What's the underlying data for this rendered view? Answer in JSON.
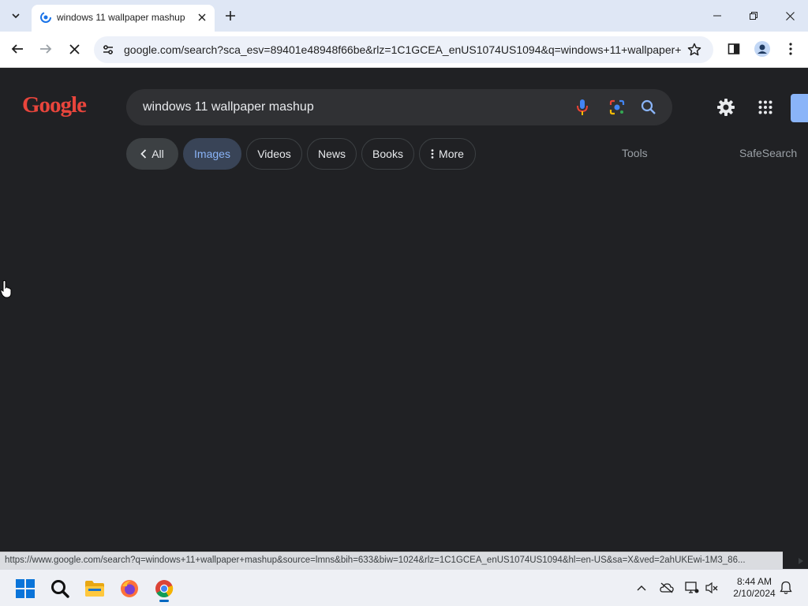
{
  "browser": {
    "tab_title": "windows 11 wallpaper mashup",
    "url": "google.com/search?sca_esv=89401e48948f66be&rlz=1C1GCEA_enUS1074US1094&q=windows+11+wallpaper+..."
  },
  "google": {
    "logo_text": "Google",
    "search_query": "windows 11 wallpaper mashup",
    "chips": {
      "all": "All",
      "images": "Images",
      "videos": "Videos",
      "news": "News",
      "books": "Books",
      "more": "More"
    },
    "tools": "Tools",
    "safesearch": "SafeSearch"
  },
  "status_url": "https://www.google.com/search?q=windows+11+wallpaper+mashup&source=lmns&bih=633&biw=1024&rlz=1C1GCEA_enUS1074US1094&hl=en-US&sa=X&ved=2ahUKEwi-1M3_86...",
  "taskbar": {
    "time": "8:44 AM",
    "date": "2/10/2024"
  },
  "colors": {
    "page_bg": "#202124",
    "logo": "#e8453c",
    "images_chip_text": "#8ab4f8",
    "accent": "#0067c0"
  }
}
